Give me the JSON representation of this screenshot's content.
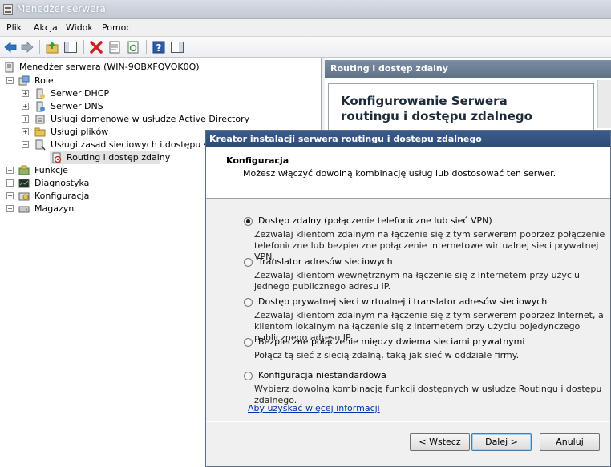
{
  "window": {
    "title": "Menedżer serwera",
    "icon": "server-manager-icon"
  },
  "menu": [
    "Plik",
    "Akcja",
    "Widok",
    "Pomoc"
  ],
  "toolbar": {
    "icons": [
      "back-icon",
      "forward-icon",
      "up-folder-icon",
      "show-hide-tree-icon",
      "delete-icon",
      "properties-icon",
      "refresh-icon",
      "help-icon",
      "show-action-pane-icon"
    ]
  },
  "tree": {
    "root": "Menedżer serwera (WIN-9OBXFQVOK0Q)",
    "role": "Role",
    "role_items": [
      "Serwer DHCP",
      "Serwer DNS",
      "Usługi domenowe w usłudze Active Directory",
      "Usługi plików",
      "Usługi zasad sieciowych i dostępu sieciow"
    ],
    "selected": "Routing i dostęp zdalny",
    "others": [
      "Funkcje",
      "Diagnostyka",
      "Konfiguracja",
      "Magazyn"
    ]
  },
  "right_pane": {
    "header": "Routing i dostęp zdalny",
    "title_line1": "Konfigurowanie Serwera",
    "title_line2": "routingu i dostępu zdalnego"
  },
  "dialog": {
    "title": "Kreator instalacji serwera routingu i dostępu zdalnego",
    "heading": "Konfiguracja",
    "subheading": "Możesz włączyć dowolną kombinację usług lub dostosować ten serwer.",
    "options": [
      {
        "label": "Dostęp zdalny (połączenie telefoniczne lub sieć VPN)",
        "desc": "Zezwalaj klientom zdalnym na łączenie się z tym serwerem poprzez połączenie telefoniczne lub bezpieczne połączenie internetowe wirtualnej sieci prywatnej VPN.",
        "selected": true
      },
      {
        "label": "Translator adresów sieciowych",
        "desc": "Zezwalaj klientom wewnętrznym na łączenie się z Internetem przy użyciu jednego publicznego adresu IP.",
        "selected": false
      },
      {
        "label": "Dostęp prywatnej sieci wirtualnej i translator adresów sieciowych",
        "desc": "Zezwalaj klientom zdalnym na łączenie się z tym serwerem poprzez Internet, a klientom lokalnym na łączenie się z Internetem przy użyciu pojedynczego publicznego adresu IP.",
        "selected": false
      },
      {
        "label": "Bezpieczne połączenie między dwiema sieciami prywatnymi",
        "desc": "Połącz tą sieć z siecią zdalną, taką jak sieć w oddziale firmy.",
        "selected": false
      },
      {
        "label": "Konfiguracja niestandardowa",
        "desc": "Wybierz dowolną kombinację funkcji dostępnych w usłudze Routingu i dostępu zdalnego.",
        "selected": false
      }
    ],
    "more_info_link": "Aby uzyskać więcej informacji",
    "buttons": {
      "back": "< Wstecz",
      "next": "Dalej >",
      "cancel": "Anuluj"
    }
  }
}
